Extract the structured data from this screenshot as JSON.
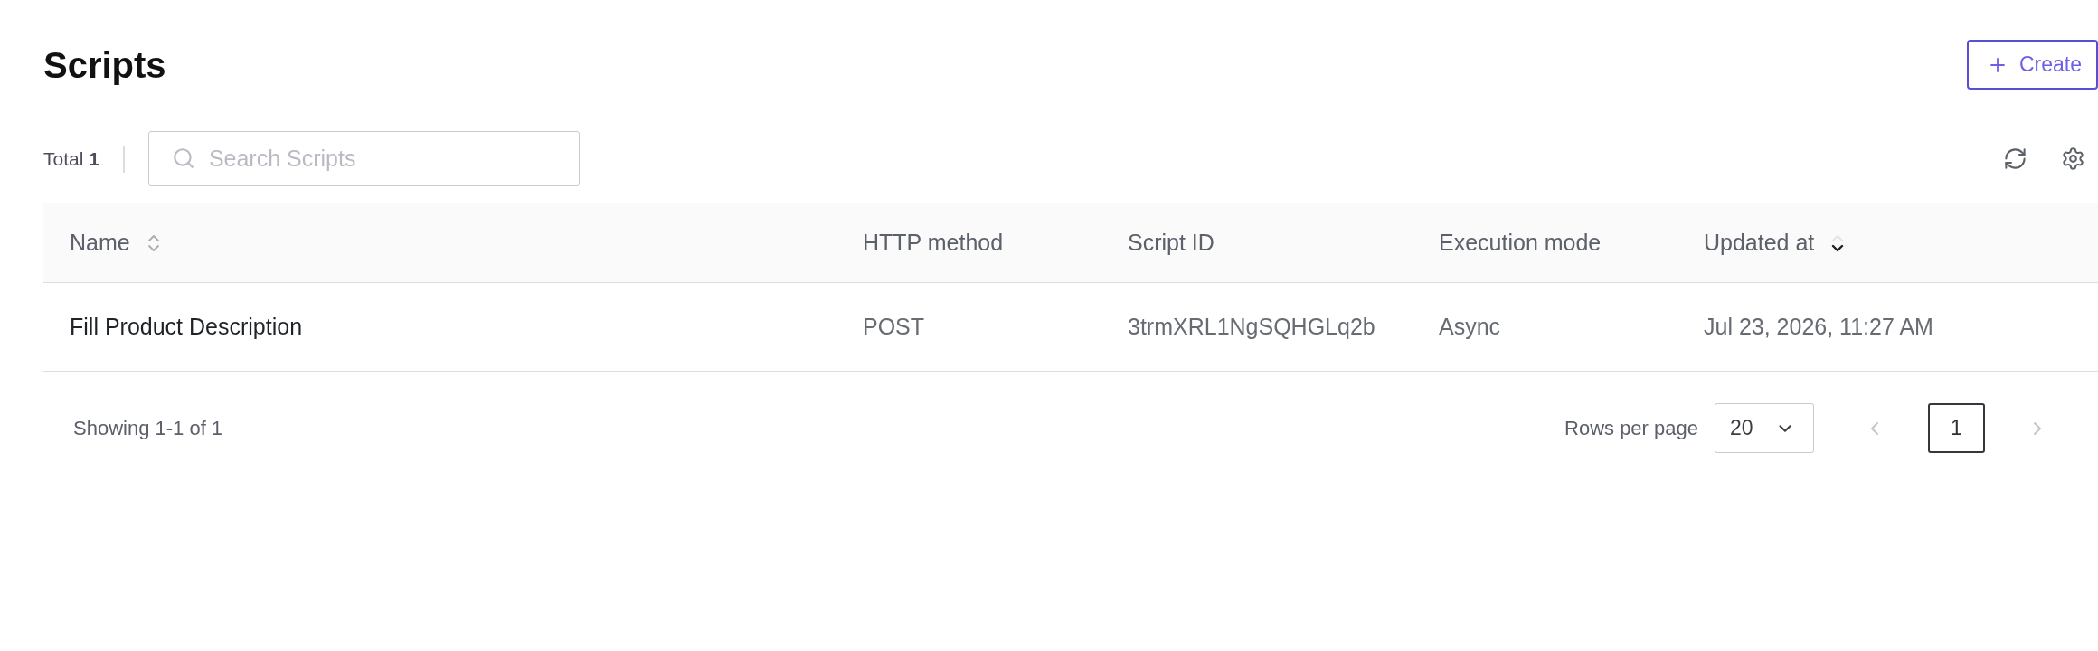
{
  "page": {
    "title": "Scripts",
    "create_button": {
      "label": "Create"
    }
  },
  "toolbar": {
    "total": "Total **1**",
    "search": {
      "placeholder": "Search Scripts"
    }
  },
  "table": {
    "columns": [
      {
        "label": "Name",
        "sorted": false
      },
      {
        "label": "HTTP method"
      },
      {
        "label": "Script ID"
      },
      {
        "label": "Execution mode"
      },
      {
        "label": "Updated at",
        "sorted": true
      }
    ],
    "rows": [
      {
        "cells": [
          "Fill Product Description",
          "POST",
          "3trmXRL1NgSQHGLq2b",
          "Async",
          "Jul 23, 2026, 11:27 AM"
        ]
      }
    ]
  },
  "footer": {
    "summary": "Showing 1-1 of 1",
    "rows_per_page_label": "Rows per page",
    "rows_per_page": "20",
    "prev_disabled": true,
    "next_disabled": true,
    "pages": [
      {
        "label": "1",
        "selected": true
      }
    ]
  }
}
